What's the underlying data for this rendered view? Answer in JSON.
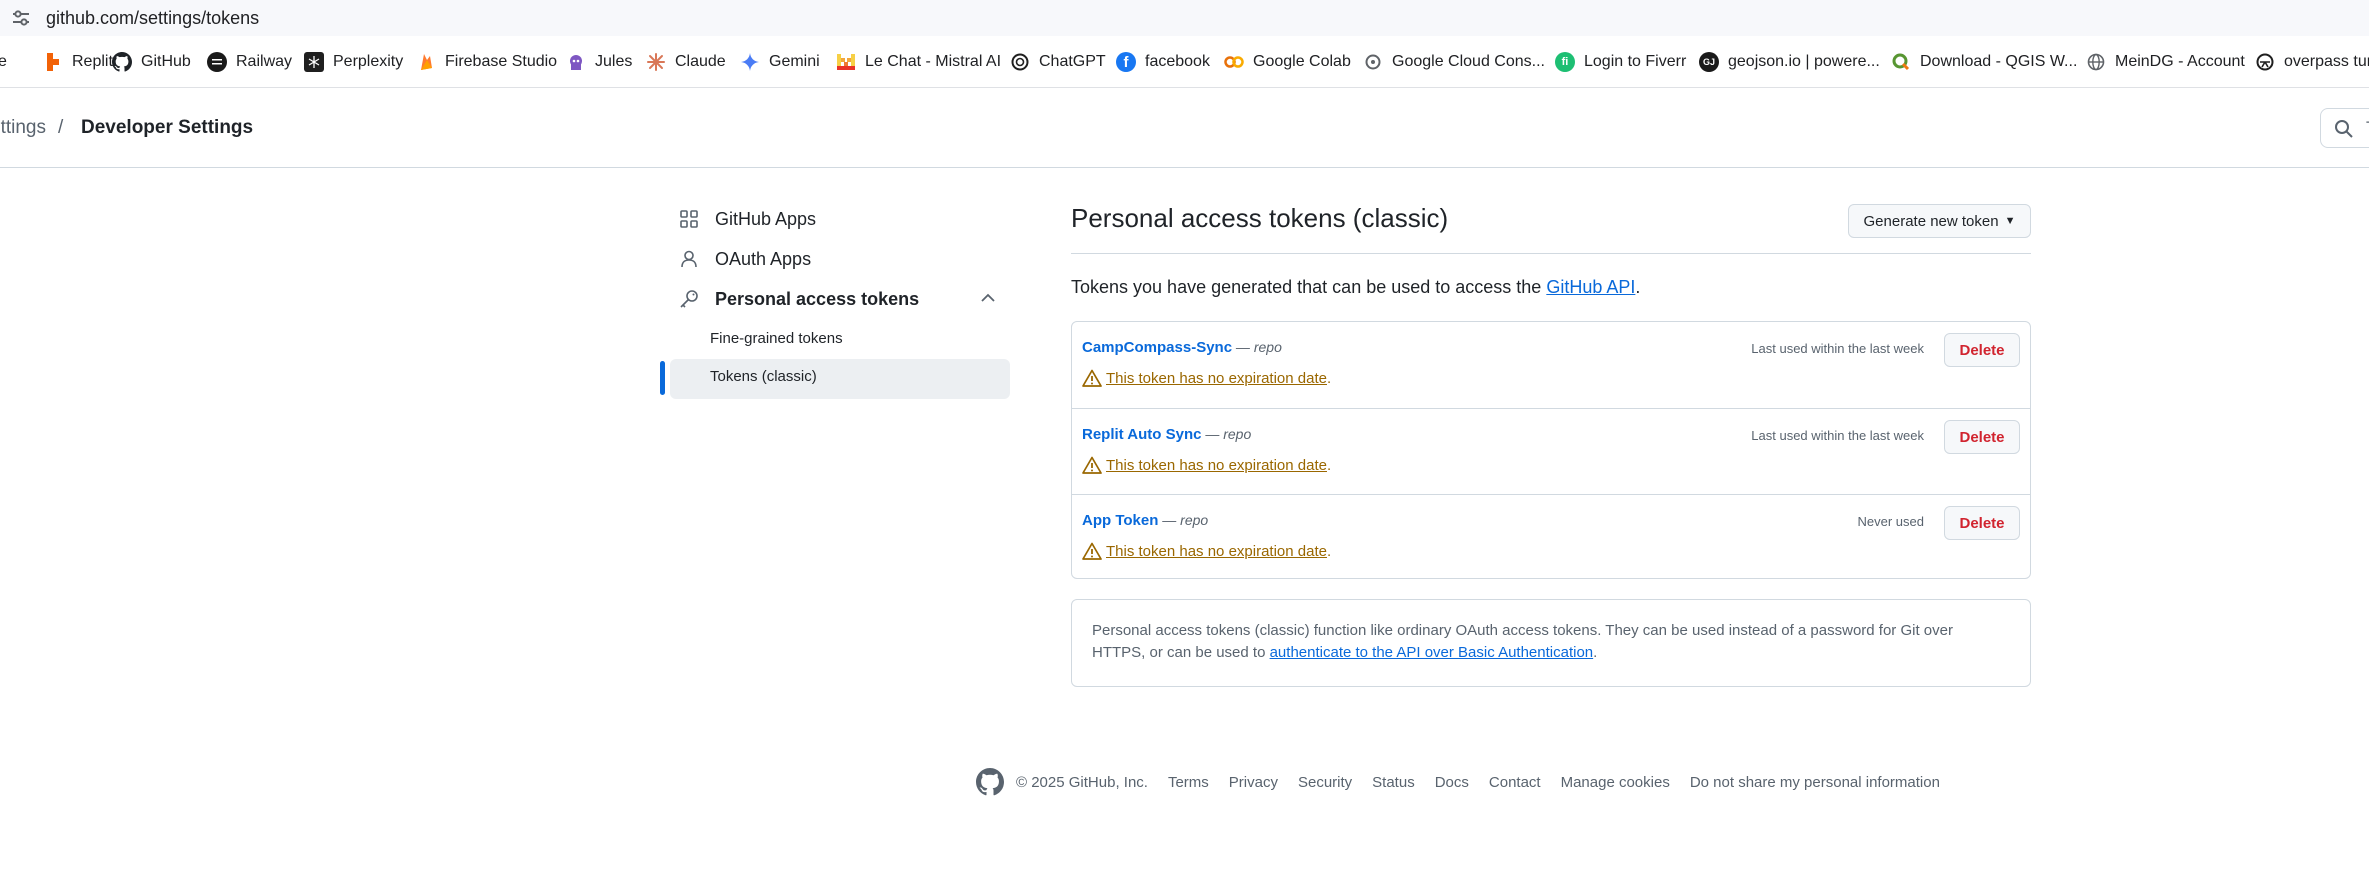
{
  "browser": {
    "url": "github.com/settings/tokens",
    "bookmarks": [
      {
        "label": "e",
        "icon": "bookmark-icon"
      },
      {
        "label": "Replit",
        "icon": "replit-icon"
      },
      {
        "label": "GitHub",
        "icon": "github-icon"
      },
      {
        "label": "Railway",
        "icon": "railway-icon"
      },
      {
        "label": "Perplexity",
        "icon": "perplexity-icon"
      },
      {
        "label": "Firebase Studio",
        "icon": "firebase-icon"
      },
      {
        "label": "Jules",
        "icon": "jules-icon"
      },
      {
        "label": "Claude",
        "icon": "claude-icon"
      },
      {
        "label": "Gemini",
        "icon": "gemini-icon"
      },
      {
        "label": "Le Chat - Mistral AI",
        "icon": "mistral-icon"
      },
      {
        "label": "ChatGPT",
        "icon": "chatgpt-icon"
      },
      {
        "label": "facebook",
        "icon": "facebook-icon"
      },
      {
        "label": "Google Colab",
        "icon": "colab-icon"
      },
      {
        "label": "Google Cloud Cons...",
        "icon": "google-cloud-icon"
      },
      {
        "label": "Login to Fiverr",
        "icon": "fiverr-icon"
      },
      {
        "label": "geojson.io | powere...",
        "icon": "geojson-icon"
      },
      {
        "label": "Download - QGIS W...",
        "icon": "qgis-icon"
      },
      {
        "label": "MeinDG - Account",
        "icon": "globe-icon"
      },
      {
        "label": "overpass turb",
        "icon": "overpass-icon"
      }
    ]
  },
  "header": {
    "breadcrumb_prev": "ettings",
    "breadcrumb_sep": "/",
    "breadcrumb_current": "Developer Settings",
    "search_placeholder": "T"
  },
  "sidebar": {
    "items": [
      {
        "label": "GitHub Apps",
        "icon": "apps-grid-icon"
      },
      {
        "label": "OAuth Apps",
        "icon": "person-icon"
      },
      {
        "label": "Personal access tokens",
        "icon": "key-icon"
      }
    ],
    "sub_items": [
      {
        "label": "Fine-grained tokens"
      },
      {
        "label": "Tokens (classic)",
        "active": true
      }
    ]
  },
  "main": {
    "title": "Personal access tokens (classic)",
    "generate_button": "Generate new token",
    "intro_text": "Tokens you have generated that can be used to access the ",
    "intro_link": "GitHub API",
    "intro_end": ".",
    "tokens": [
      {
        "name": "CampCompass-Sync",
        "dash": " — ",
        "scope": "repo",
        "warning": "This token has no expiration date",
        "warning_end": ".",
        "last_used": "Last used within the last week",
        "delete_label": "Delete"
      },
      {
        "name": "Replit Auto Sync",
        "dash": " — ",
        "scope": "repo",
        "warning": "This token has no expiration date",
        "warning_end": ".",
        "last_used": "Last used within the last week",
        "delete_label": "Delete"
      },
      {
        "name": "App Token",
        "dash": " — ",
        "scope": "repo",
        "warning": "This token has no expiration date",
        "warning_end": ".",
        "last_used": "Never used",
        "delete_label": "Delete"
      }
    ],
    "info_text": "Personal access tokens (classic) function like ordinary OAuth access tokens. They can be used instead of a password for Git over HTTPS, or can be used to ",
    "info_link": "authenticate to the API over Basic Authentication",
    "info_end": "."
  },
  "footer": {
    "copyright": "© 2025 GitHub, Inc.",
    "links": [
      "Terms",
      "Privacy",
      "Security",
      "Status",
      "Docs",
      "Contact",
      "Manage cookies",
      "Do not share my personal information"
    ]
  },
  "colors": {
    "link": "#0969da",
    "danger": "#d1242f",
    "warning": "#9a6700",
    "muted": "#59636e",
    "border": "#d1d9e0"
  }
}
